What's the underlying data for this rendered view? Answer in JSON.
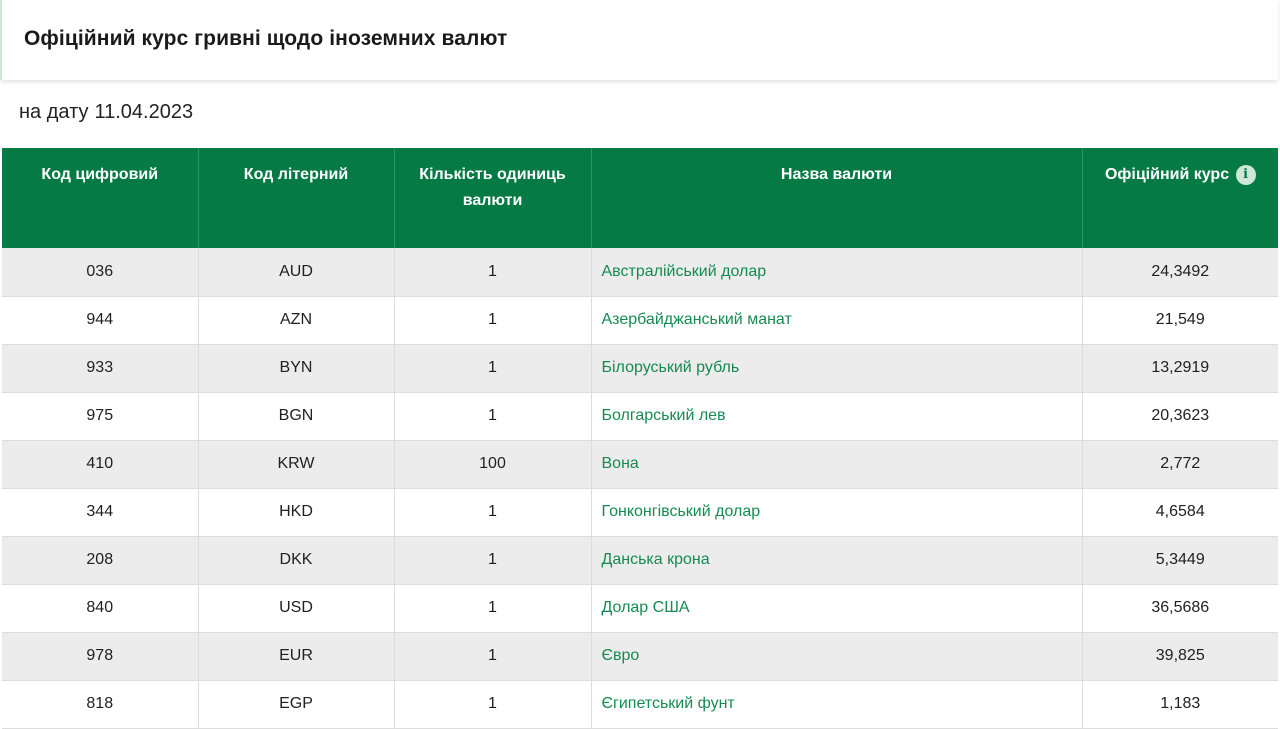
{
  "header": {
    "title": "Офіційний курс гривні щодо іноземних валют"
  },
  "date": {
    "label": "на дату",
    "value": "11.04.2023"
  },
  "table": {
    "headers": {
      "numeric_code": "Код цифровий",
      "letter_code": "Код літерний",
      "units": "Кількість одиниць валюти",
      "name": "Назва валюти",
      "rate": "Офіційний курс"
    },
    "info_icon": "info-icon",
    "rows": [
      {
        "numeric_code": "036",
        "letter_code": "AUD",
        "units": "1",
        "name": "Австралійський долар",
        "rate": "24,3492"
      },
      {
        "numeric_code": "944",
        "letter_code": "AZN",
        "units": "1",
        "name": "Азербайджанський манат",
        "rate": "21,549"
      },
      {
        "numeric_code": "933",
        "letter_code": "BYN",
        "units": "1",
        "name": "Білоруський рубль",
        "rate": "13,2919"
      },
      {
        "numeric_code": "975",
        "letter_code": "BGN",
        "units": "1",
        "name": "Болгарський лев",
        "rate": "20,3623"
      },
      {
        "numeric_code": "410",
        "letter_code": "KRW",
        "units": "100",
        "name": "Вона",
        "rate": "2,772"
      },
      {
        "numeric_code": "344",
        "letter_code": "HKD",
        "units": "1",
        "name": "Гонконгівський долар",
        "rate": "4,6584"
      },
      {
        "numeric_code": "208",
        "letter_code": "DKK",
        "units": "1",
        "name": "Данська крона",
        "rate": "5,3449"
      },
      {
        "numeric_code": "840",
        "letter_code": "USD",
        "units": "1",
        "name": "Долар США",
        "rate": "36,5686"
      },
      {
        "numeric_code": "978",
        "letter_code": "EUR",
        "units": "1",
        "name": "Євро",
        "rate": "39,825"
      },
      {
        "numeric_code": "818",
        "letter_code": "EGP",
        "units": "1",
        "name": "Єгипетський фунт",
        "rate": "1,183"
      }
    ]
  },
  "colors": {
    "header_green": "#057a45",
    "link_green": "#168a52",
    "row_stripe": "#ececec"
  }
}
